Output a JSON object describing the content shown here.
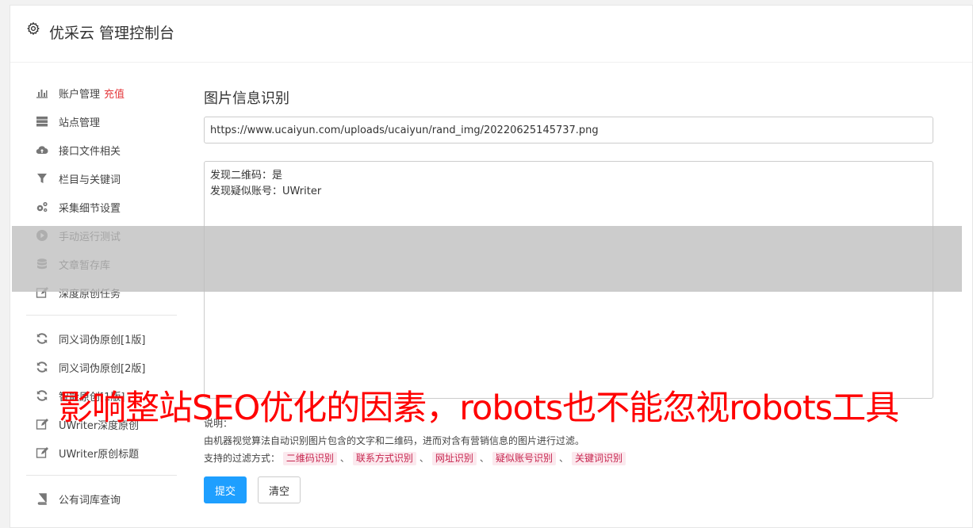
{
  "header": {
    "title": "优采云 管理控制台",
    "icon": "gear-icon"
  },
  "sidebar": {
    "group1": [
      {
        "label": "账户管理",
        "badge": "充值",
        "icon": "bar-chart-icon"
      },
      {
        "label": "站点管理",
        "icon": "server-icon"
      },
      {
        "label": "接口文件相关",
        "icon": "cloud-upload-icon"
      },
      {
        "label": "栏目与关键词",
        "icon": "filter-icon"
      },
      {
        "label": "采集细节设置",
        "icon": "gears-icon"
      },
      {
        "label": "手动运行测试",
        "icon": "play-circle-icon"
      },
      {
        "label": "文章暂存库",
        "icon": "database-icon"
      },
      {
        "label": "深度原创任务",
        "icon": "edit-icon"
      }
    ],
    "group2": [
      {
        "label": "同义词伪原创[1版]",
        "icon": "refresh-icon"
      },
      {
        "label": "同义词伪原创[2版]",
        "icon": "refresh-icon"
      },
      {
        "label": "智能原创[1版]",
        "icon": "refresh-icon"
      },
      {
        "label": "UWriter深度原创",
        "icon": "edit-icon"
      },
      {
        "label": "UWriter原创标题",
        "icon": "edit-icon"
      }
    ],
    "group3": [
      {
        "label": "公有词库查询",
        "icon": "book-icon"
      }
    ]
  },
  "main": {
    "title": "图片信息识别",
    "url_value": "https://www.ucaiyun.com/uploads/ucaiyun/rand_img/20220625145737.png",
    "result_lines": [
      "发现二维码：是",
      "发现疑似账号：UWriter"
    ],
    "note_label": "说明：",
    "note_text": "由机器视觉算法自动识别图片包含的文字和二维码，进而对含有营销信息的图片进行过滤。",
    "filter_label": "支持的过滤方式：",
    "filter_tags": [
      "二维码识别",
      "联系方式识别",
      "网址识别",
      "疑似账号识别",
      "关键词识别"
    ],
    "filter_sep": "、",
    "submit_label": "提交",
    "clear_label": "清空"
  },
  "overlay": {
    "watermark": "影响整站SEO优化的因素，robots也不能忽视robots工具"
  },
  "colors": {
    "primary": "#1e9fff",
    "badge_red": "#e4393c",
    "tag_text": "#c7254e",
    "tag_bg": "#fbe9ee",
    "watermark": "#ff0000"
  }
}
